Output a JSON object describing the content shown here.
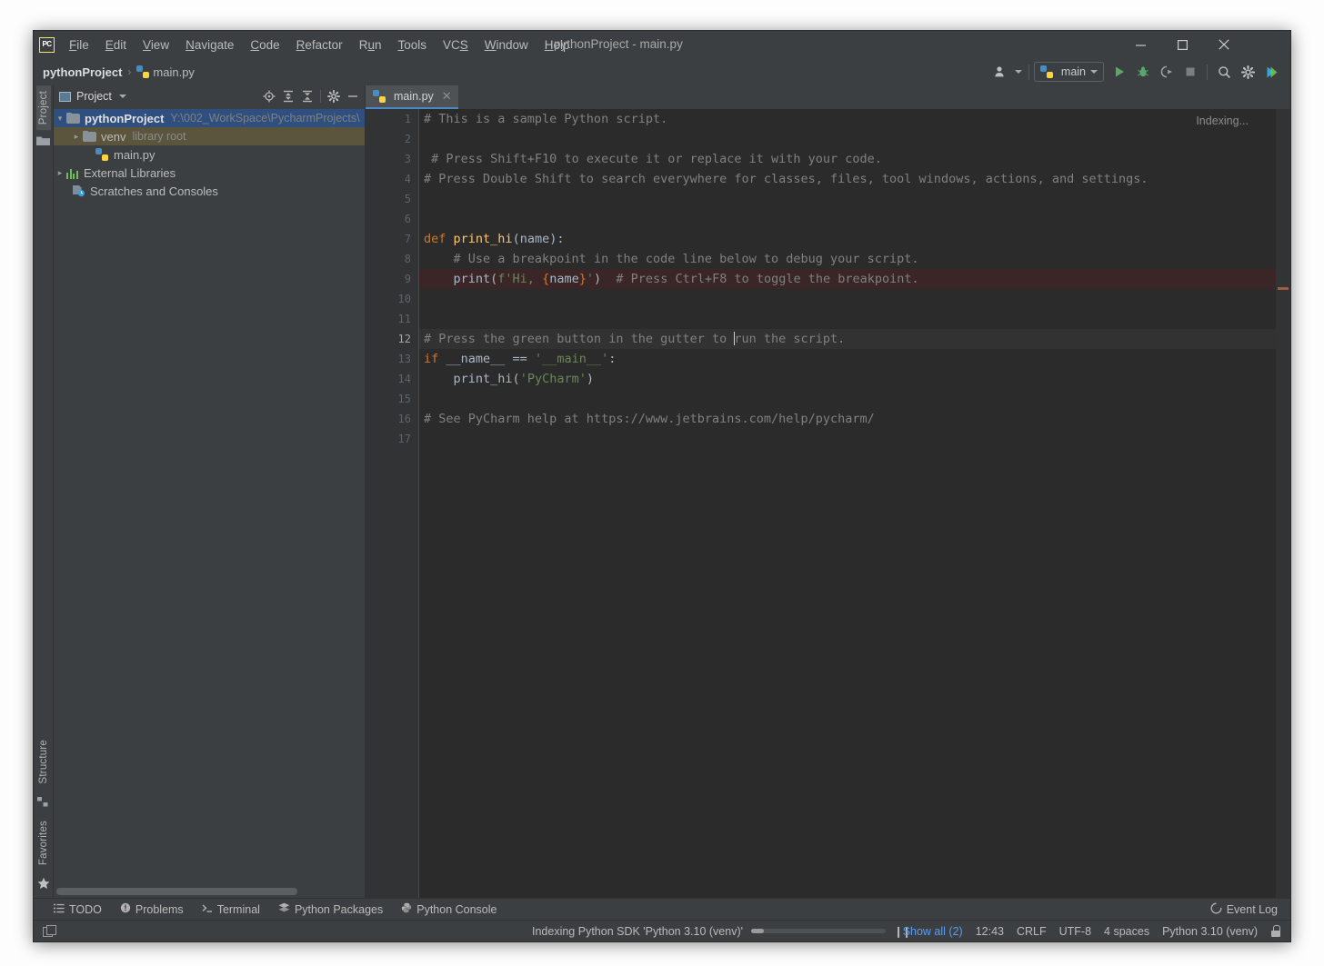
{
  "window": {
    "title": "pythonProject - main.py",
    "logo": "pycharm-logo",
    "minimize": "─",
    "maximize": "☐",
    "close": "✕"
  },
  "menubar": {
    "items": [
      {
        "label": "File",
        "mnemonic": "F"
      },
      {
        "label": "Edit",
        "mnemonic": "E"
      },
      {
        "label": "View",
        "mnemonic": "V"
      },
      {
        "label": "Navigate",
        "mnemonic": "N"
      },
      {
        "label": "Code",
        "mnemonic": "C"
      },
      {
        "label": "Refactor",
        "mnemonic": "R"
      },
      {
        "label": "Run",
        "mnemonic": "u"
      },
      {
        "label": "Tools",
        "mnemonic": "T"
      },
      {
        "label": "VCS",
        "mnemonic": "S"
      },
      {
        "label": "Window",
        "mnemonic": "W"
      },
      {
        "label": "Help",
        "mnemonic": "H"
      }
    ]
  },
  "navbar": {
    "project_crumb": "pythonProject",
    "separator": "›",
    "file_crumb": "main.py"
  },
  "toolbar": {
    "run_config": "main",
    "icons": [
      "user-avatar-icon",
      "run-icon",
      "debug-icon",
      "run-coverage-icon",
      "stop-icon",
      "search-everywhere-icon",
      "settings-icon",
      "ai-assistant-icon"
    ]
  },
  "left_strip": {
    "top_tab": "Project",
    "bottom_tabs": [
      "Structure",
      "Favorites"
    ]
  },
  "project_panel": {
    "title": "Project",
    "tools": [
      "locate-icon",
      "expand-all-icon",
      "collapse-all-icon",
      "settings-icon",
      "hide-icon"
    ],
    "tree": [
      {
        "label": "pythonProject",
        "path": "Y:\\002_WorkSpace\\PycharmProjects\\",
        "icon": "folder-icon",
        "state": "selected",
        "arrow": "∨",
        "indent": 0
      },
      {
        "label": "venv",
        "sub": "library root",
        "icon": "folder-icon",
        "state": "hovered",
        "arrow": "›",
        "indent": 1
      },
      {
        "label": "main.py",
        "icon": "python-file-icon",
        "state": "normal",
        "arrow": "",
        "indent": 2
      },
      {
        "label": "External Libraries",
        "icon": "libraries-icon",
        "state": "normal",
        "arrow": "›",
        "indent": 0
      },
      {
        "label": "Scratches and Consoles",
        "icon": "scratches-icon",
        "state": "normal",
        "arrow": "",
        "indent": 1
      }
    ]
  },
  "editor": {
    "tab": {
      "label": "main.py",
      "icon": "python-file-icon",
      "close": "✕"
    },
    "indexing_label": "Indexing...",
    "breakpoint_line": 9,
    "caret_line": 12,
    "lines": [
      {
        "n": "1",
        "fold": "minus"
      },
      {
        "n": "2"
      },
      {
        "n": "3"
      },
      {
        "n": "4",
        "fold": "minus"
      },
      {
        "n": "5"
      },
      {
        "n": "6"
      },
      {
        "n": "7",
        "fold": "minus"
      },
      {
        "n": "8"
      },
      {
        "n": "9",
        "fold": "plain"
      },
      {
        "n": "10"
      },
      {
        "n": "11"
      },
      {
        "n": "12"
      },
      {
        "n": "13"
      },
      {
        "n": "14"
      },
      {
        "n": "15"
      },
      {
        "n": "16"
      },
      {
        "n": "17"
      }
    ],
    "code": {
      "l1": "# This is a sample Python script.",
      "l3": "# Press Shift+F10 to execute it or replace it with your code.",
      "l4": "# Press Double Shift to search everywhere for classes, files, tool windows, actions, and settings.",
      "l7_kw": "def",
      "l7_fn": "print_hi",
      "l7_rest": "(name):",
      "l8": "# Use a breakpoint in the code line below to debug your script.",
      "l9_call": "print(",
      "l9_str_a": "f'Hi, ",
      "l9_brace_open": "{",
      "l9_name": "name",
      "l9_brace_close": "}",
      "l9_str_b": "'",
      "l9_close": ")",
      "l9_comment": "# Press Ctrl+F8 to toggle the breakpoint.",
      "l12_a": "# Press the green button in the gutter to ",
      "l12_b": "run the script.",
      "l13_kw": "if",
      "l13_id": " __name__ == ",
      "l13_str": "'__main__'",
      "l13_colon": ":",
      "l14_fn": "print_hi",
      "l14_paren_open": "(",
      "l14_str": "'PyCharm'",
      "l14_paren_close": ")",
      "l16": "# See PyCharm help at https://www.jetbrains.com/help/pycharm/"
    }
  },
  "tool_window_bar": {
    "items": [
      {
        "label": "TODO",
        "icon": "todo-icon"
      },
      {
        "label": "Problems",
        "icon": "problems-icon"
      },
      {
        "label": "Terminal",
        "icon": "terminal-icon"
      },
      {
        "label": "Python Packages",
        "icon": "packages-icon"
      },
      {
        "label": "Python Console",
        "icon": "python-console-icon"
      }
    ],
    "event_log": {
      "label": "Event Log",
      "icon": "event-log-icon"
    }
  },
  "statusbar": {
    "progress_text": "Indexing Python SDK 'Python 3.10 (venv)'",
    "pause": "❙❙",
    "show_all": "Show all (2)",
    "position": "12:43",
    "line_separator": "CRLF",
    "encoding": "UTF-8",
    "indent": "4 spaces",
    "interpreter": "Python 3.10 (venv)",
    "lock": "lock-icon"
  },
  "colors": {
    "bg_chrome": "#3c3f41",
    "bg_editor": "#2b2b2b",
    "accent_blue": "#4a88c7",
    "link_blue": "#589df6",
    "breakpoint_red": "#db5c5c",
    "keyword_orange": "#cc7832",
    "string_green": "#6a8759",
    "function_yellow": "#ffc66d",
    "comment_gray": "#808080",
    "selection_blue": "#2f4f7f",
    "hover_olive": "#5c553e"
  }
}
